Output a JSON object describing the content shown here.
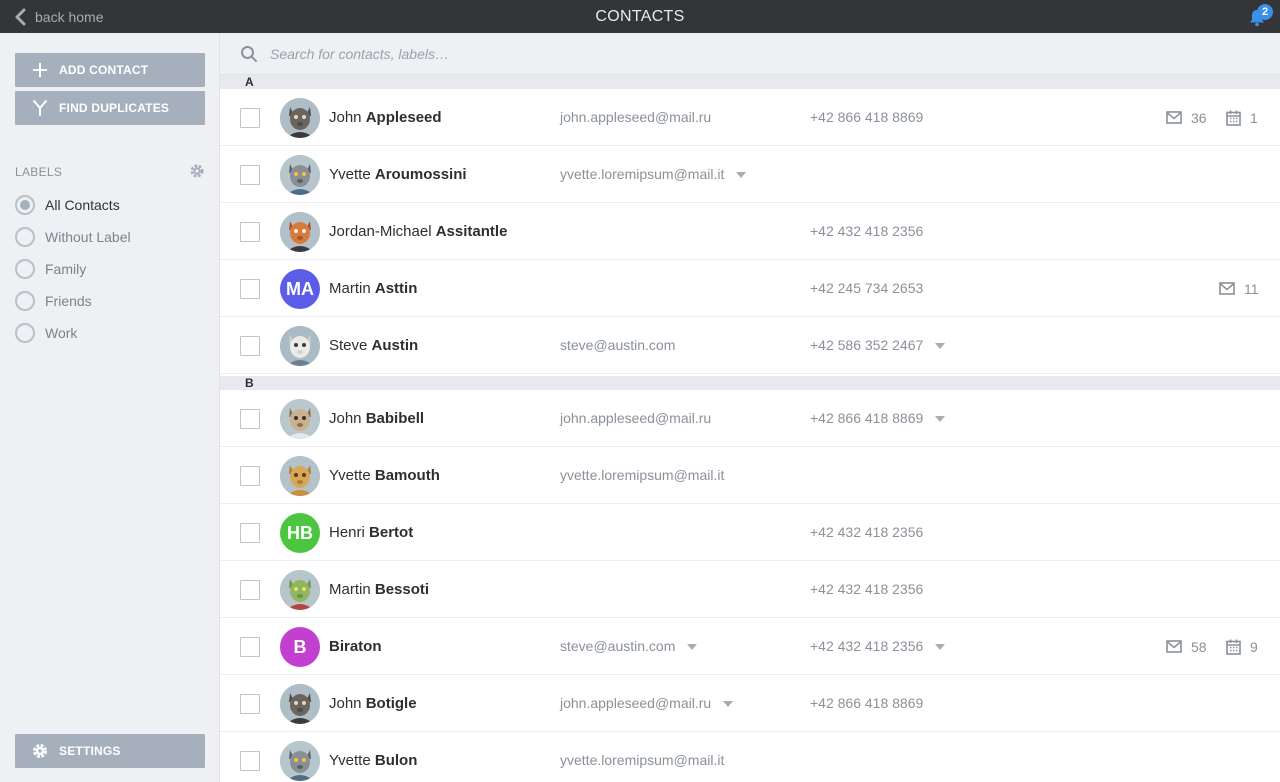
{
  "topbar": {
    "back_label": "back home",
    "title": "CONTACTS",
    "notification_count": "2"
  },
  "sidebar": {
    "add_contact": "ADD CONTACT",
    "find_duplicates": "FIND DUPLICATES",
    "labels_heading": "LABELS",
    "labels": [
      {
        "label": "All Contacts",
        "checked": true
      },
      {
        "label": "Without Label",
        "checked": false
      },
      {
        "label": "Family",
        "checked": false
      },
      {
        "label": "Friends",
        "checked": false
      },
      {
        "label": "Work",
        "checked": false
      }
    ],
    "settings": "SETTINGS"
  },
  "search": {
    "placeholder": "Search for contacts, labels…"
  },
  "sections": [
    {
      "letter": "A",
      "contacts": [
        {
          "first": "John",
          "last": "Appleseed",
          "avatar": "wolf-avatar",
          "email": "john.appleseed@mail.ru",
          "email_caret": false,
          "phone": "+42 866 418 8869",
          "phone_caret": false,
          "mail_count": "36",
          "event_count": "1"
        },
        {
          "first": "Yvette",
          "last": "Aroumossini",
          "avatar": "lemur-avatar",
          "email": "yvette.loremipsum@mail.it",
          "email_caret": true,
          "phone": "",
          "phone_caret": false,
          "mail_count": "",
          "event_count": ""
        },
        {
          "first": "Jordan-Michael",
          "last": "Assitantle",
          "avatar": "fox-avatar",
          "email": "",
          "email_caret": false,
          "phone": "+42 432 418 2356",
          "phone_caret": false,
          "mail_count": "",
          "event_count": ""
        },
        {
          "first": "Martin",
          "last": "Asttin",
          "avatar_initials": "MA",
          "avatar_color": "#5b5ce8",
          "email": "",
          "email_caret": false,
          "phone": "+42 245 734 2653",
          "phone_caret": false,
          "mail_count": "11",
          "event_count": ""
        },
        {
          "first": "Steve",
          "last": "Austin",
          "avatar": "polar-bear-avatar",
          "email": "steve@austin.com",
          "email_caret": false,
          "phone": "+42 586 352 2467",
          "phone_caret": true,
          "mail_count": "",
          "event_count": ""
        }
      ]
    },
    {
      "letter": "B",
      "contacts": [
        {
          "first": "John",
          "last": "Babibell",
          "avatar": "meerkat-avatar",
          "email": "john.appleseed@mail.ru",
          "email_caret": false,
          "phone": "+42 866 418 8869",
          "phone_caret": true,
          "mail_count": "",
          "event_count": ""
        },
        {
          "first": "Yvette",
          "last": "Bamouth",
          "avatar": "lion-avatar",
          "email": "yvette.loremipsum@mail.it",
          "email_caret": false,
          "phone": "",
          "phone_caret": false,
          "mail_count": "",
          "event_count": ""
        },
        {
          "first": "Henri",
          "last": "Bertot",
          "avatar_initials": "HB",
          "avatar_color": "#4cc640",
          "email": "",
          "email_caret": false,
          "phone": "+42 432 418 2356",
          "phone_caret": false,
          "mail_count": "",
          "event_count": ""
        },
        {
          "first": "Martin",
          "last": "Bessoti",
          "avatar": "frog-avatar",
          "email": "",
          "email_caret": false,
          "phone": "+42 432 418 2356",
          "phone_caret": false,
          "mail_count": "",
          "event_count": ""
        },
        {
          "first": "",
          "last": "Biraton",
          "avatar_initials": "B",
          "avatar_color": "#c23fcf",
          "email": "steve@austin.com",
          "email_caret": true,
          "phone": "+42 432 418 2356",
          "phone_caret": true,
          "mail_count": "58",
          "event_count": "9"
        },
        {
          "first": "John",
          "last": "Botigle",
          "avatar": "wolf-avatar",
          "email": "john.appleseed@mail.ru",
          "email_caret": true,
          "phone": "+42 866 418 8869",
          "phone_caret": false,
          "mail_count": "",
          "event_count": ""
        },
        {
          "first": "Yvette",
          "last": "Bulon",
          "avatar": "lemur-avatar",
          "email": "yvette.loremipsum@mail.it",
          "email_caret": false,
          "phone": "",
          "phone_caret": false,
          "mail_count": "",
          "event_count": ""
        }
      ]
    }
  ],
  "colors": {
    "topbar": "#343538",
    "sidebar": "#eff0f3",
    "button": "#a6b0bd",
    "badge": "#3c8fe6"
  }
}
